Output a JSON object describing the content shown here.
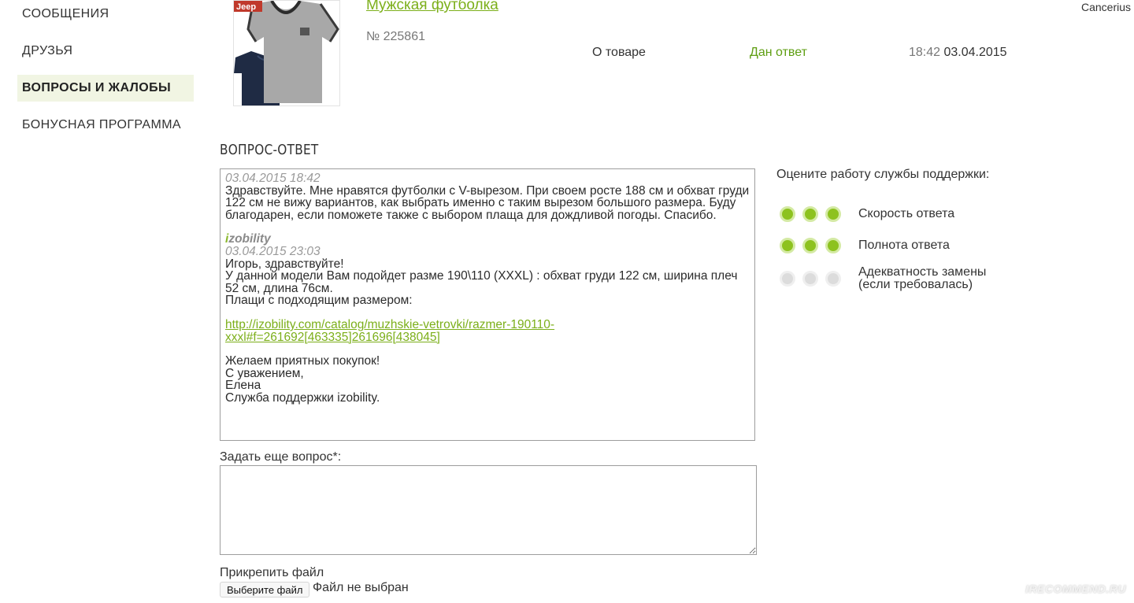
{
  "sidebar": {
    "items": [
      {
        "label": "СООБЩЕНИЯ"
      },
      {
        "label": "ДРУЗЬЯ"
      },
      {
        "label": "ВОПРОСЫ И ЖАЛОБЫ"
      },
      {
        "label": "БОНУСНАЯ ПРОГРАММА"
      }
    ]
  },
  "header": {
    "username": "Cancerius"
  },
  "product": {
    "image_text": "Jeep",
    "title": "Мужская футболка",
    "number": "№ 225861",
    "about_link": "О товаре",
    "status": "Дан ответ",
    "status_color": "#5e9e12",
    "time": "18:42",
    "date": "03.04.2015"
  },
  "section": {
    "title": "ВОПРОС-ОТВЕТ"
  },
  "conversation": {
    "question": {
      "date": "03.04.2015 18:42",
      "text": "Здравствуйте. Мне нравятся футболки с V-вырезом. При своем росте 188 см и обхват груди 122 см не вижу вариантов, как выбрать именно с таким вырезом большого размера. Буду благодарен, если поможете также с выбором плаща для дождливой погоды. Спасибо."
    },
    "answer": {
      "author_i": "i",
      "author_rest": "zobility",
      "date": "03.04.2015 23:03",
      "line1": "Игорь, здравствуйте!",
      "line2": "У данной модели Вам подойдет разме 190\\110 (XXXL) : обхват груди 122 см, ширина плеч 52 см, длина 76см.",
      "line3": "Плащи с подходящим размером:",
      "link": "http://izobility.com/catalog/muzhskie-vetrovki/razmer-190110-xxxl#f=261692[463335]261696[438045]",
      "line4": "Желаем приятных покупок!",
      "line5": "С уважением,",
      "line6": "Елена",
      "line7": "Служба поддержки izobility."
    }
  },
  "form": {
    "ask_label": "Задать еще вопрос*:",
    "ask_value": "",
    "attach_label": "Прикрепить файл",
    "file_button": "Выберите файл",
    "file_status": "Файл не выбран"
  },
  "rating": {
    "title": "Оцените работу службы поддержки:",
    "accent_color": "#8dc21f",
    "rows": [
      {
        "label": "Скорость ответа",
        "score": 3,
        "max": 3
      },
      {
        "label": "Полнота ответа",
        "score": 3,
        "max": 3
      },
      {
        "label_line1": "Адекватность замены",
        "label_line2": "(если требовалась)",
        "score": 0,
        "max": 3
      }
    ]
  },
  "watermark": "IRECOMMEND.RU"
}
